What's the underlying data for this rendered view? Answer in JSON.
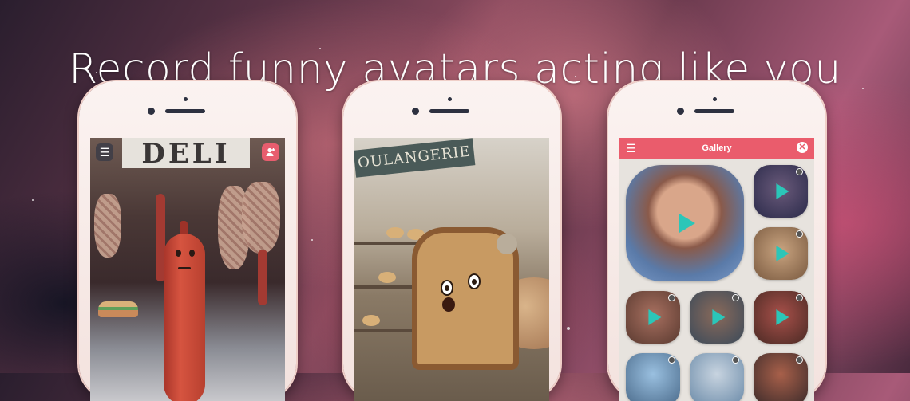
{
  "headline": "Record funny avatars acting like you",
  "phone1": {
    "sign_text": "DELI",
    "menu_icon": "menu-icon",
    "contact_icon": "contact-add-icon"
  },
  "phone2": {
    "sign_text": "OULANGERIE"
  },
  "phone3": {
    "header_title": "Gallery",
    "menu_icon": "hamburger-icon",
    "close_icon": "close-icon",
    "accent_color": "#ea5c6c",
    "play_color": "#2bc6b8"
  }
}
